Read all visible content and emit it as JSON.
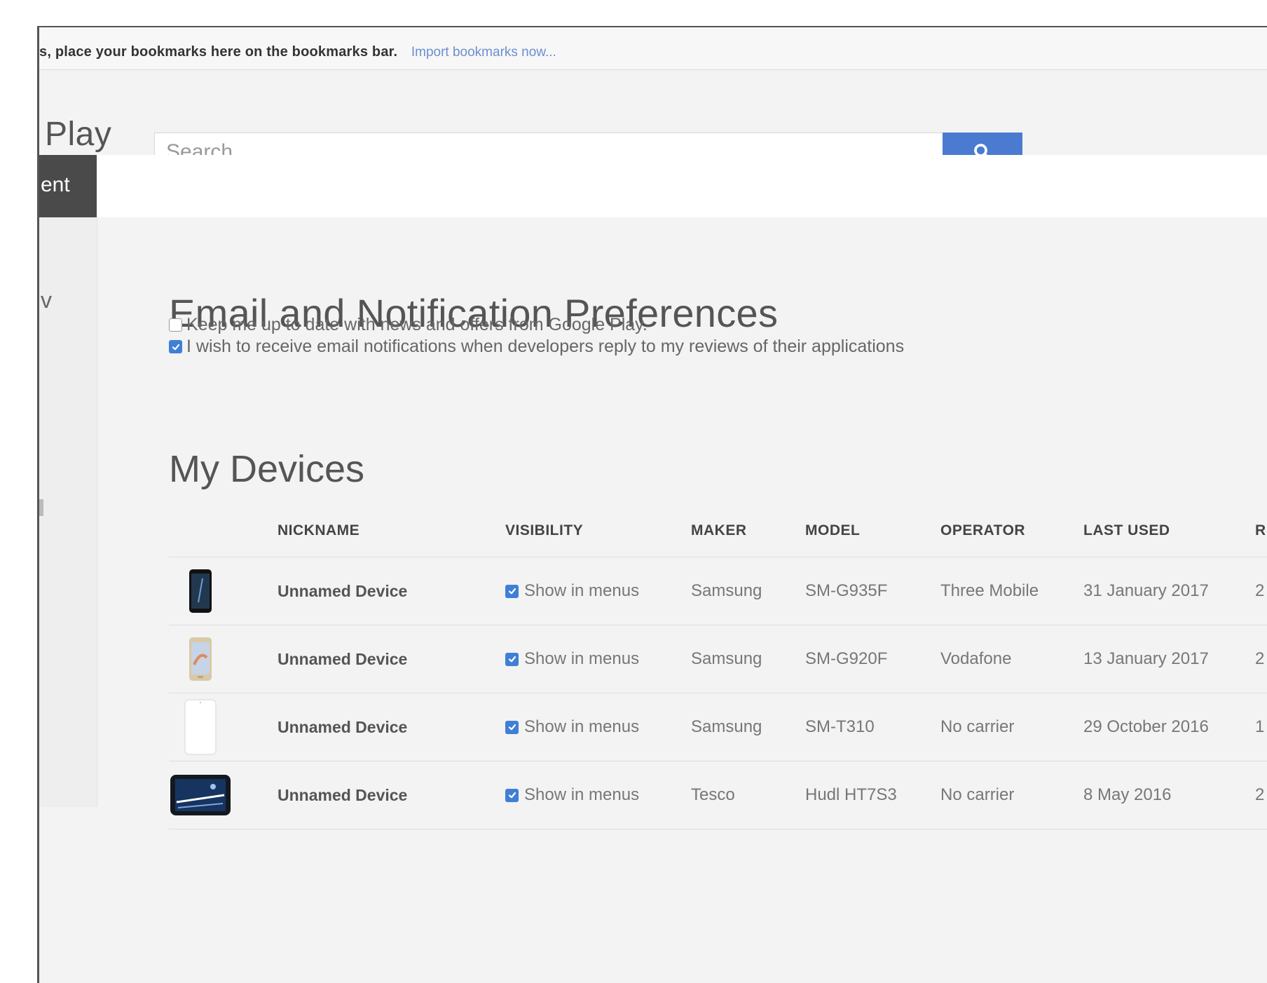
{
  "bookmarks_bar": {
    "message": "s, place your bookmarks here on the bookmarks bar.",
    "import_link": "Import bookmarks now..."
  },
  "header": {
    "logo_text": "Play",
    "search_placeholder": "Search",
    "search_icon": "search-icon",
    "accent_color": "#4a7bd0"
  },
  "nav": {
    "active_fragment": "ent",
    "sidebar_fragment": "v"
  },
  "preferences": {
    "title": "Email and Notification Preferences",
    "options": [
      {
        "label": "Keep me up to date with news and offers from Google Play.",
        "checked": false
      },
      {
        "label": "I wish to receive email notifications when developers reply to my reviews of their applications",
        "checked": true
      }
    ]
  },
  "devices": {
    "title": "My Devices",
    "columns": [
      "NICKNAME",
      "VISIBILITY",
      "MAKER",
      "MODEL",
      "OPERATOR",
      "LAST USED",
      "RE"
    ],
    "rows": [
      {
        "image": "phone-black-icon",
        "nickname": "Unnamed Device",
        "visibility": "Show in menus",
        "visible": true,
        "maker": "Samsung",
        "model": "SM-G935F",
        "operator": "Three Mobile",
        "last_used": "31 January 2017",
        "registered": "2"
      },
      {
        "image": "phone-gold-icon",
        "nickname": "Unnamed Device",
        "visibility": "Show in menus",
        "visible": true,
        "maker": "Samsung",
        "model": "SM-G920F",
        "operator": "Vodafone",
        "last_used": "13 January 2017",
        "registered": "2"
      },
      {
        "image": "tablet-white-icon",
        "nickname": "Unnamed Device",
        "visibility": "Show in menus",
        "visible": true,
        "maker": "Samsung",
        "model": "SM-T310",
        "operator": "No carrier",
        "last_used": "29 October 2016",
        "registered": "1"
      },
      {
        "image": "tablet-landscape-icon",
        "nickname": "Unnamed Device",
        "visibility": "Show in menus",
        "visible": true,
        "maker": "Tesco",
        "model": "Hudl HT7S3",
        "operator": "No carrier",
        "last_used": "8 May 2016",
        "registered": "2"
      }
    ]
  }
}
